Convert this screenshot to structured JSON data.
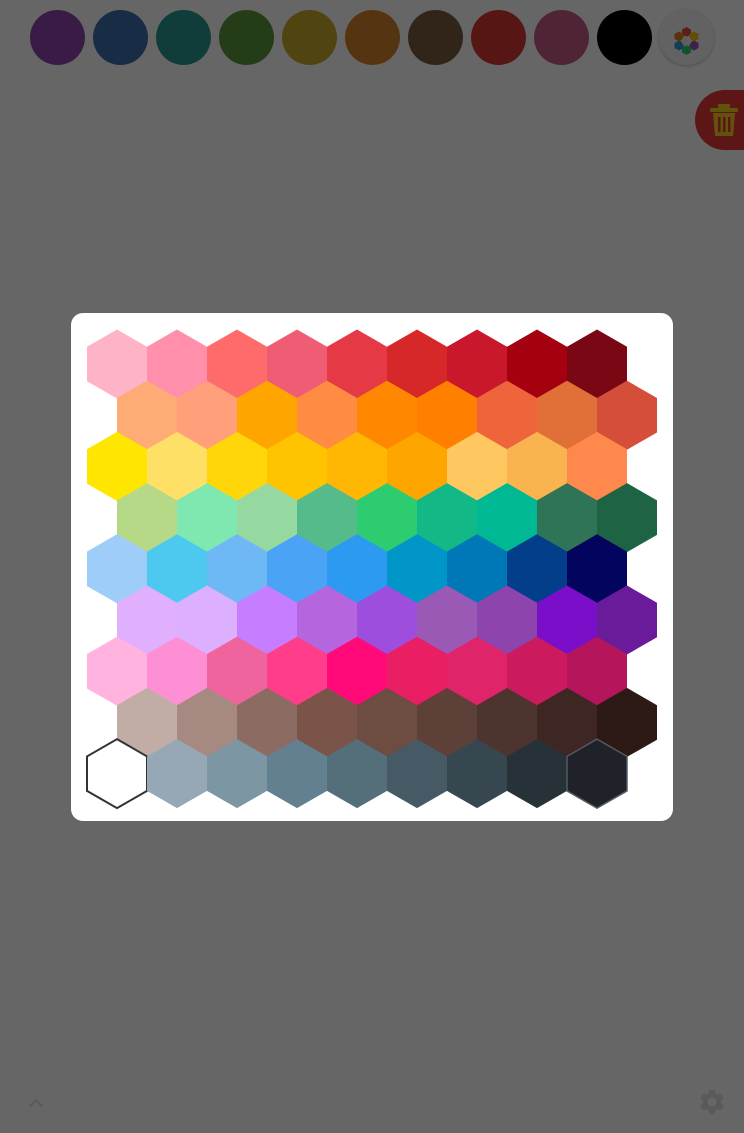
{
  "toolbar": {
    "swatches": [
      {
        "name": "purple",
        "color": "#8e44ad"
      },
      {
        "name": "blue",
        "color": "#3f6fb0"
      },
      {
        "name": "teal",
        "color": "#2a9a8f"
      },
      {
        "name": "green",
        "color": "#5a9a3c"
      },
      {
        "name": "yellow",
        "color": "#c9ad2a"
      },
      {
        "name": "orange",
        "color": "#d4862b"
      },
      {
        "name": "brown",
        "color": "#7b5a3c"
      },
      {
        "name": "red",
        "color": "#d63a33"
      },
      {
        "name": "pink",
        "color": "#c75a8a"
      },
      {
        "name": "black",
        "color": "#000000"
      }
    ],
    "palette_icon": "hexagon-palette-icon"
  },
  "trash_icon": "trash-icon",
  "footer": {
    "expand_icon": "chevron-up-icon",
    "settings_icon": "gear-icon"
  },
  "color_picker": {
    "rows": [
      [
        "#ffb3c6",
        "#ff8fab",
        "#ff6b6b",
        "#ee5d73",
        "#e63946",
        "#d62828",
        "#c9182b",
        "#a4000f",
        "#7a0714"
      ],
      [
        "#ffab76",
        "#ffa07a",
        "#ffa500",
        "#ff8c42",
        "#ff8800",
        "#ff8000",
        "#f0643c",
        "#e07038",
        "#d44e3a"
      ],
      [
        "#ffe600",
        "#ffe066",
        "#ffd60a",
        "#ffc300",
        "#ffb703",
        "#ffa500",
        "#ffc75f",
        "#f9b44f",
        "#ff884d"
      ],
      [
        "#b5d987",
        "#7ee8b0",
        "#95d9a0",
        "#55bb8a",
        "#2ecc71",
        "#12b886",
        "#00b894",
        "#2f7457",
        "#1e6444"
      ],
      [
        "#9ecdf9",
        "#4dc9f0",
        "#6db8f5",
        "#4ba3f5",
        "#2b9af0",
        "#0096c7",
        "#0077b6",
        "#023e8a",
        "#03045e"
      ],
      [
        "#e0b0ff",
        "#dcb0ff",
        "#c77dff",
        "#b566de",
        "#9d4edd",
        "#9b59b6",
        "#8e44ad",
        "#7b0fc9",
        "#6a1b9a"
      ],
      [
        "#ffb3de",
        "#ff8fd4",
        "#f0649d",
        "#ff3d8b",
        "#ff0a78",
        "#e91e63",
        "#e0246a",
        "#cc1a5e",
        "#b5155a"
      ],
      [
        "#c2aca6",
        "#a68a82",
        "#8c6b62",
        "#7a5448",
        "#6d4c41",
        "#5d4037",
        "#4e342e",
        "#3e2723",
        "#2e1a15"
      ],
      [
        "#ffffff",
        "#96a8b5",
        "#7c96a3",
        "#62808f",
        "#546e7a",
        "#455a64",
        "#37474f",
        "#263238",
        "#1f2229"
      ]
    ]
  }
}
